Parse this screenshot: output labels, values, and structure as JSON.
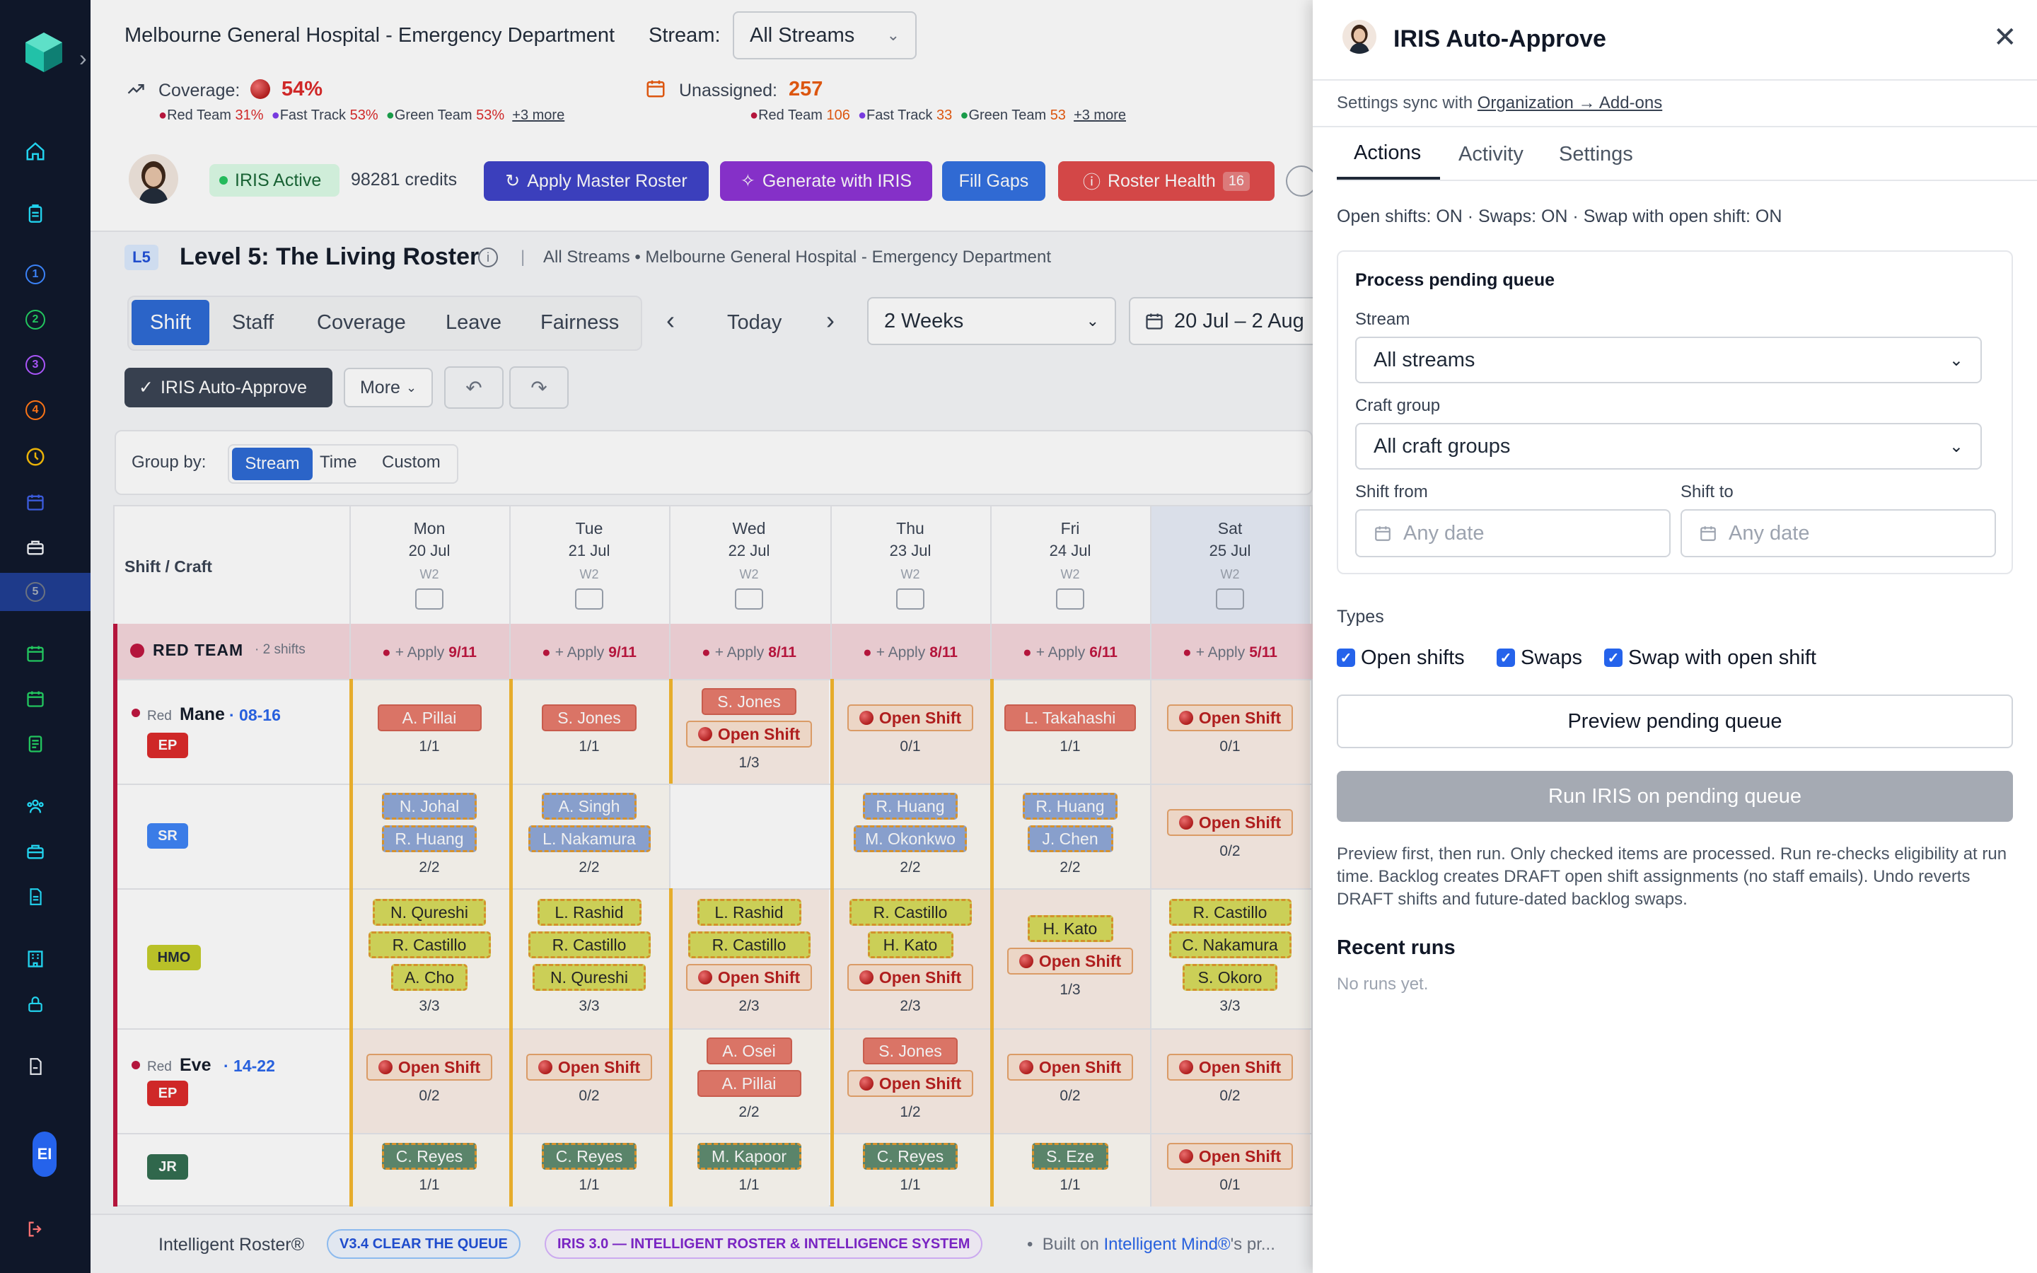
{
  "sidebar": {
    "avatar": "EI",
    "levels": [
      "1",
      "2",
      "3",
      "4",
      "5"
    ]
  },
  "header": {
    "hospital": "Melbourne General Hospital - Emergency Department",
    "stream_label": "Stream:",
    "stream_value": "All Streams",
    "coverage_label": "Coverage:",
    "coverage_value": "54%",
    "coverage_teams": [
      {
        "name": "Red Team",
        "value": "31%",
        "color": "#be123c"
      },
      {
        "name": "Fast Track",
        "value": "53%",
        "color": "#7c3aed"
      },
      {
        "name": "Green Team",
        "value": "53%",
        "color": "#16a34a"
      }
    ],
    "coverage_more": "+3 more",
    "unassigned_label": "Unassigned:",
    "unassigned_value": "257",
    "unassigned_teams": [
      {
        "name": "Red Team",
        "value": "106",
        "color": "#be123c"
      },
      {
        "name": "Fast Track",
        "value": "33",
        "color": "#7c3aed"
      },
      {
        "name": "Green Team",
        "value": "53",
        "color": "#16a34a"
      }
    ],
    "unassigned_more": "+3 more"
  },
  "toolbar": {
    "iris_status": "IRIS Active",
    "credits": "98281 credits",
    "apply_master": "Apply Master Roster",
    "generate": "Generate with IRIS",
    "fill_gaps": "Fill Gaps",
    "roster_health": "Roster Health",
    "roster_health_count": "16"
  },
  "level": {
    "badge": "L5",
    "title": "Level 5: The Living Roster",
    "context": "All Streams • Melbourne General Hospital - Emergency Department"
  },
  "view_tabs": [
    "Shift",
    "Staff",
    "Coverage",
    "Leave",
    "Fairness"
  ],
  "nav": {
    "today": "Today",
    "range": "2 Weeks",
    "dates": "20 Jul – 2 Aug"
  },
  "actions": {
    "auto_approve": "IRIS Auto-Approve",
    "more": "More"
  },
  "group_by": {
    "label": "Group by:",
    "options": [
      "Stream",
      "Time",
      "Custom"
    ]
  },
  "grid": {
    "corner": "Shift / Craft",
    "days": [
      {
        "dow": "Mon",
        "date": "20 Jul",
        "week": "W2",
        "apply": "9/11"
      },
      {
        "dow": "Tue",
        "date": "21 Jul",
        "week": "W2",
        "apply": "9/11"
      },
      {
        "dow": "Wed",
        "date": "22 Jul",
        "week": "W2",
        "apply": "8/11"
      },
      {
        "dow": "Thu",
        "date": "23 Jul",
        "week": "W2",
        "apply": "8/11"
      },
      {
        "dow": "Fri",
        "date": "24 Jul",
        "week": "W2",
        "apply": "6/11"
      },
      {
        "dow": "Sat",
        "date": "25 Jul",
        "week": "W2",
        "apply": "5/11"
      }
    ],
    "apply_label": "+ Apply",
    "team": {
      "name": "RED TEAM",
      "shifts": "· 2 shifts"
    },
    "shift1": {
      "team": "Red",
      "name": "Mane",
      "time": "· 08-16"
    },
    "shift2": {
      "team": "Red",
      "name": "Eve",
      "time": "· 14-22"
    },
    "crafts": {
      "ep": "EP",
      "sr": "SR",
      "hmo": "HMO",
      "ep2": "EP",
      "jr": "JR"
    },
    "open_shift": "Open Shift",
    "rows": {
      "ep": {
        "cells": [
          {
            "pills": [
              {
                "t": "A. Pillai",
                "k": "red"
              }
            ],
            "count": "1/1"
          },
          {
            "pills": [
              {
                "t": "S. Jones",
                "k": "red"
              }
            ],
            "count": "1/1"
          },
          {
            "pills": [
              {
                "t": "S. Jones",
                "k": "red"
              },
              {
                "t": "Open Shift",
                "k": "open"
              }
            ],
            "count": "1/3"
          },
          {
            "pills": [
              {
                "t": "Open Shift",
                "k": "open"
              }
            ],
            "count": "0/1"
          },
          {
            "pills": [
              {
                "t": "L. Takahashi",
                "k": "red"
              }
            ],
            "count": "1/1"
          },
          {
            "pills": [
              {
                "t": "Open Shift",
                "k": "open"
              }
            ],
            "count": "0/1"
          }
        ]
      },
      "sr": {
        "cells": [
          {
            "pills": [
              {
                "t": "N. Johal",
                "k": "blue"
              },
              {
                "t": "R. Huang",
                "k": "blue"
              }
            ],
            "count": "2/2"
          },
          {
            "pills": [
              {
                "t": "A. Singh",
                "k": "blue"
              },
              {
                "t": "L. Nakamura",
                "k": "blue"
              }
            ],
            "count": "2/2"
          },
          {
            "pills": [],
            "count": ""
          },
          {
            "pills": [
              {
                "t": "R. Huang",
                "k": "blue"
              },
              {
                "t": "M. Okonkwo",
                "k": "blue"
              }
            ],
            "count": "2/2"
          },
          {
            "pills": [
              {
                "t": "R. Huang",
                "k": "blue"
              },
              {
                "t": "J. Chen",
                "k": "blue"
              }
            ],
            "count": "2/2"
          },
          {
            "pills": [
              {
                "t": "Open Shift",
                "k": "open"
              }
            ],
            "count": "0/2"
          }
        ]
      },
      "hmo": {
        "cells": [
          {
            "pills": [
              {
                "t": "N. Qureshi",
                "k": "yel"
              },
              {
                "t": "R. Castillo",
                "k": "yel"
              },
              {
                "t": "A. Cho",
                "k": "yel"
              }
            ],
            "count": "3/3"
          },
          {
            "pills": [
              {
                "t": "L. Rashid",
                "k": "yel"
              },
              {
                "t": "R. Castillo",
                "k": "yel"
              },
              {
                "t": "N. Qureshi",
                "k": "yel"
              }
            ],
            "count": "3/3"
          },
          {
            "pills": [
              {
                "t": "L. Rashid",
                "k": "yel"
              },
              {
                "t": "R. Castillo",
                "k": "yel"
              },
              {
                "t": "Open Shift",
                "k": "open"
              }
            ],
            "count": "2/3"
          },
          {
            "pills": [
              {
                "t": "R. Castillo",
                "k": "yel"
              },
              {
                "t": "H. Kato",
                "k": "yel"
              },
              {
                "t": "Open Shift",
                "k": "open"
              }
            ],
            "count": "2/3"
          },
          {
            "pills": [
              {
                "t": "H. Kato",
                "k": "yel"
              },
              {
                "t": "Open Shift",
                "k": "open"
              }
            ],
            "count": "1/3"
          },
          {
            "pills": [
              {
                "t": "R. Castillo",
                "k": "yel"
              },
              {
                "t": "C. Nakamura",
                "k": "yel"
              },
              {
                "t": "S. Okoro",
                "k": "yel"
              }
            ],
            "count": "3/3"
          }
        ]
      },
      "ep2": {
        "cells": [
          {
            "pills": [
              {
                "t": "Open Shift",
                "k": "open"
              }
            ],
            "count": "0/2"
          },
          {
            "pills": [
              {
                "t": "Open Shift",
                "k": "open"
              }
            ],
            "count": "0/2"
          },
          {
            "pills": [
              {
                "t": "A. Osei",
                "k": "red"
              },
              {
                "t": "A. Pillai",
                "k": "red"
              }
            ],
            "count": "2/2"
          },
          {
            "pills": [
              {
                "t": "S. Jones",
                "k": "red"
              },
              {
                "t": "Open Shift",
                "k": "open"
              }
            ],
            "count": "1/2"
          },
          {
            "pills": [
              {
                "t": "Open Shift",
                "k": "open"
              }
            ],
            "count": "0/2"
          },
          {
            "pills": [
              {
                "t": "Open Shift",
                "k": "open"
              }
            ],
            "count": "0/2"
          }
        ]
      },
      "jr": {
        "cells": [
          {
            "pills": [
              {
                "t": "C. Reyes",
                "k": "grn"
              }
            ],
            "count": "1/1"
          },
          {
            "pills": [
              {
                "t": "C. Reyes",
                "k": "grn"
              }
            ],
            "count": "1/1"
          },
          {
            "pills": [
              {
                "t": "M. Kapoor",
                "k": "grn"
              }
            ],
            "count": "1/1"
          },
          {
            "pills": [
              {
                "t": "C. Reyes",
                "k": "grn"
              }
            ],
            "count": "1/1"
          },
          {
            "pills": [
              {
                "t": "S. Eze",
                "k": "grn"
              }
            ],
            "count": "1/1"
          },
          {
            "pills": [
              {
                "t": "Open Shift",
                "k": "open"
              }
            ],
            "count": "0/1"
          }
        ]
      }
    }
  },
  "footer": {
    "brand": "Intelligent Roster®",
    "version": "V3.4 CLEAR THE QUEUE",
    "iris": "IRIS 3.0 — INTELLIGENT ROSTER & INTELLIGENCE SYSTEM",
    "sep": "•",
    "built": "Built on",
    "mind": "Intelligent Mind®",
    "rest": "'s pr..."
  },
  "panel": {
    "title": "IRIS Auto-Approve",
    "sync_text": "Settings sync with",
    "sync_link": "Organization → Add-ons",
    "tabs": [
      "Actions",
      "Activity",
      "Settings"
    ],
    "status": "Open shifts: ON · Swaps: ON · Swap with open shift: ON",
    "queue_title": "Process pending queue",
    "stream_label": "Stream",
    "stream_value": "All streams",
    "craft_label": "Craft group",
    "craft_value": "All craft groups",
    "from_label": "Shift from",
    "to_label": "Shift to",
    "date_placeholder": "Any date",
    "types_label": "Types",
    "types": [
      "Open shifts",
      "Swaps",
      "Swap with open shift"
    ],
    "preview_btn": "Preview pending queue",
    "run_btn": "Run IRIS on pending queue",
    "help": "Preview first, then run. Only checked items are processed. Run re-checks eligibility at run time. Backlog creates DRAFT open shift assignments (no staff emails). Undo reverts DRAFT shifts and future-dated backlog swaps.",
    "recent_title": "Recent runs",
    "recent_empty": "No runs yet."
  }
}
